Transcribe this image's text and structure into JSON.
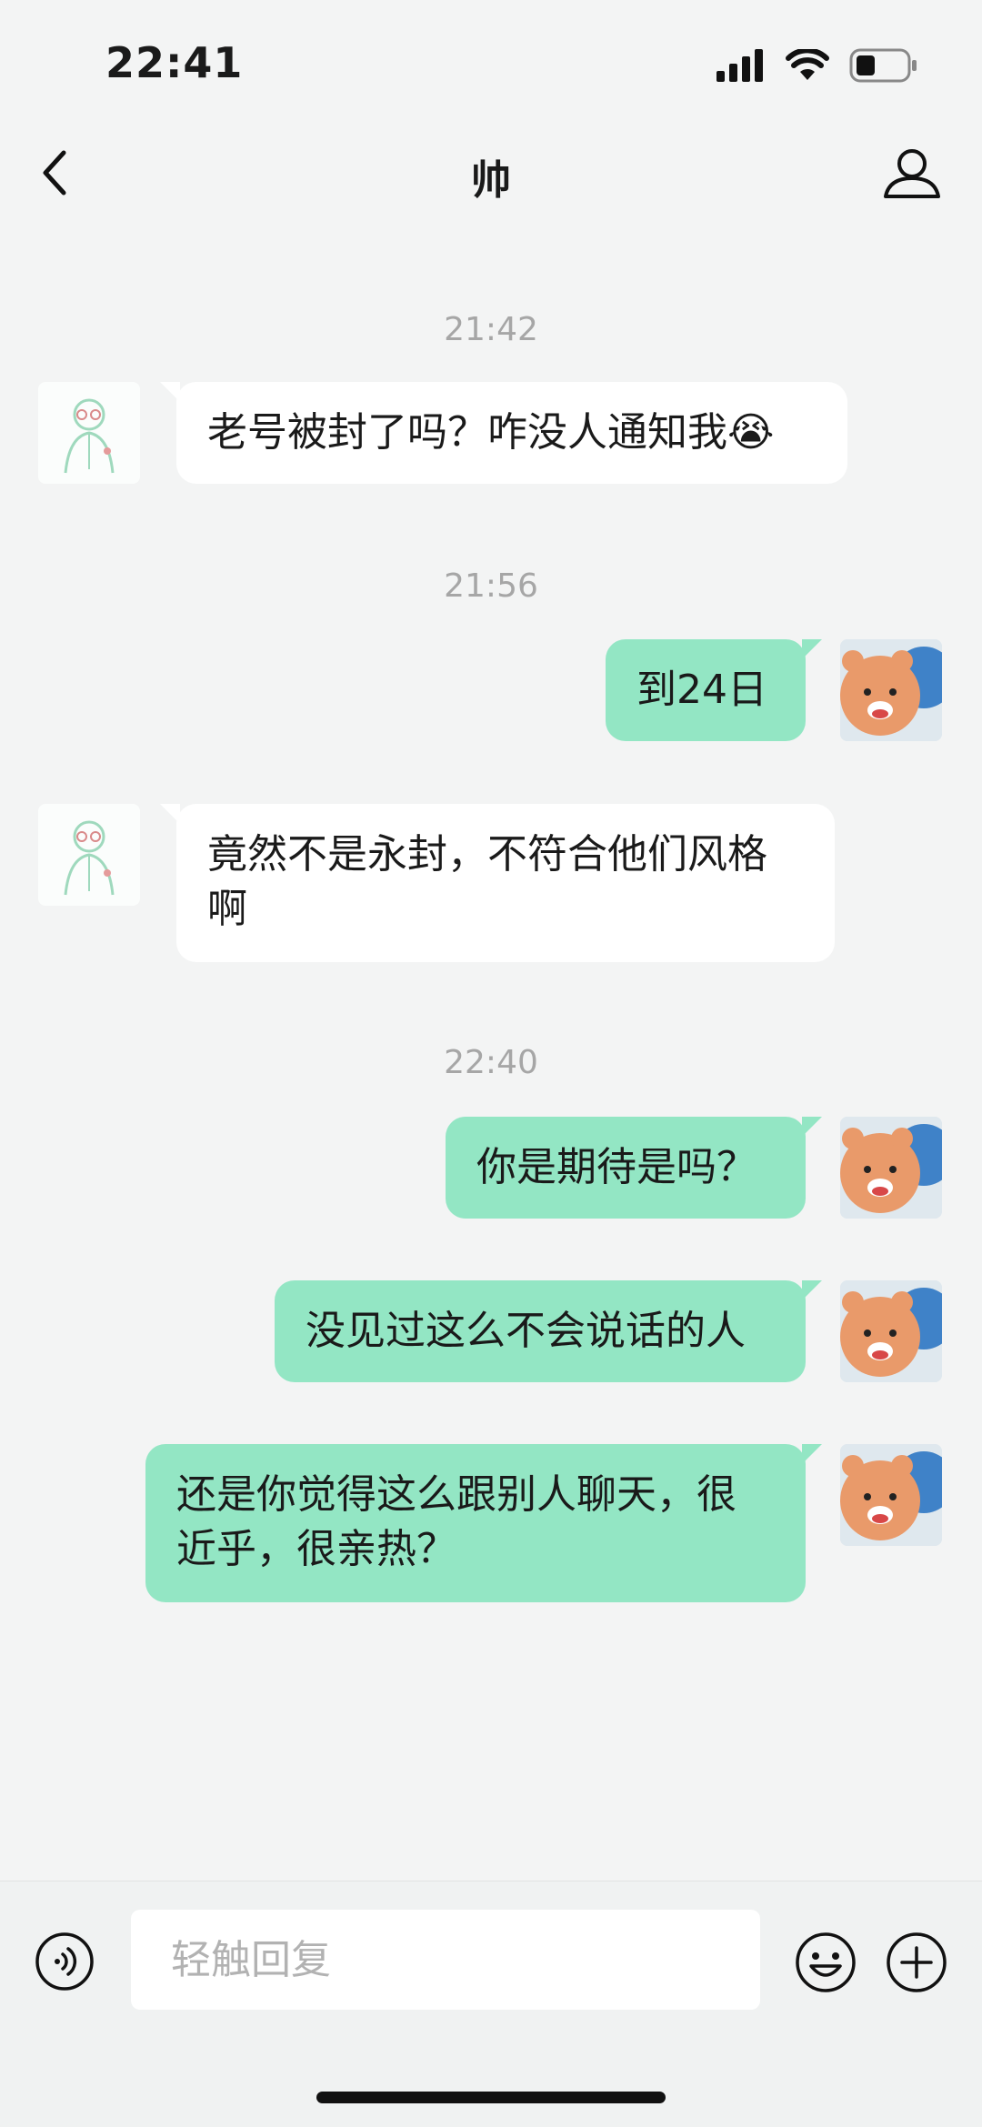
{
  "status_bar": {
    "time": "22:41"
  },
  "nav": {
    "title": "帅"
  },
  "messages": {
    "ts1": "21:42",
    "m1": "老号被封了吗？咋没人通知我😭",
    "ts2": "21:56",
    "m2": "到24日",
    "m3": "竟然不是永封，不符合他们风格啊",
    "ts3": "22:40",
    "m4": "你是期待是吗？",
    "m5": "没见过这么不会说话的人",
    "m6": "还是你觉得这么跟别人聊天，很近乎，很亲热？"
  },
  "composer": {
    "placeholder": "轻触回复"
  },
  "colors": {
    "outgoing_bubble": "#93e6c4",
    "incoming_bubble": "#ffffff",
    "background": "#f3f4f4"
  },
  "icons": [
    "signal-icon",
    "wifi-icon",
    "battery-icon",
    "back-icon",
    "contact-icon",
    "voice-icon",
    "emoji-icon",
    "plus-icon"
  ]
}
